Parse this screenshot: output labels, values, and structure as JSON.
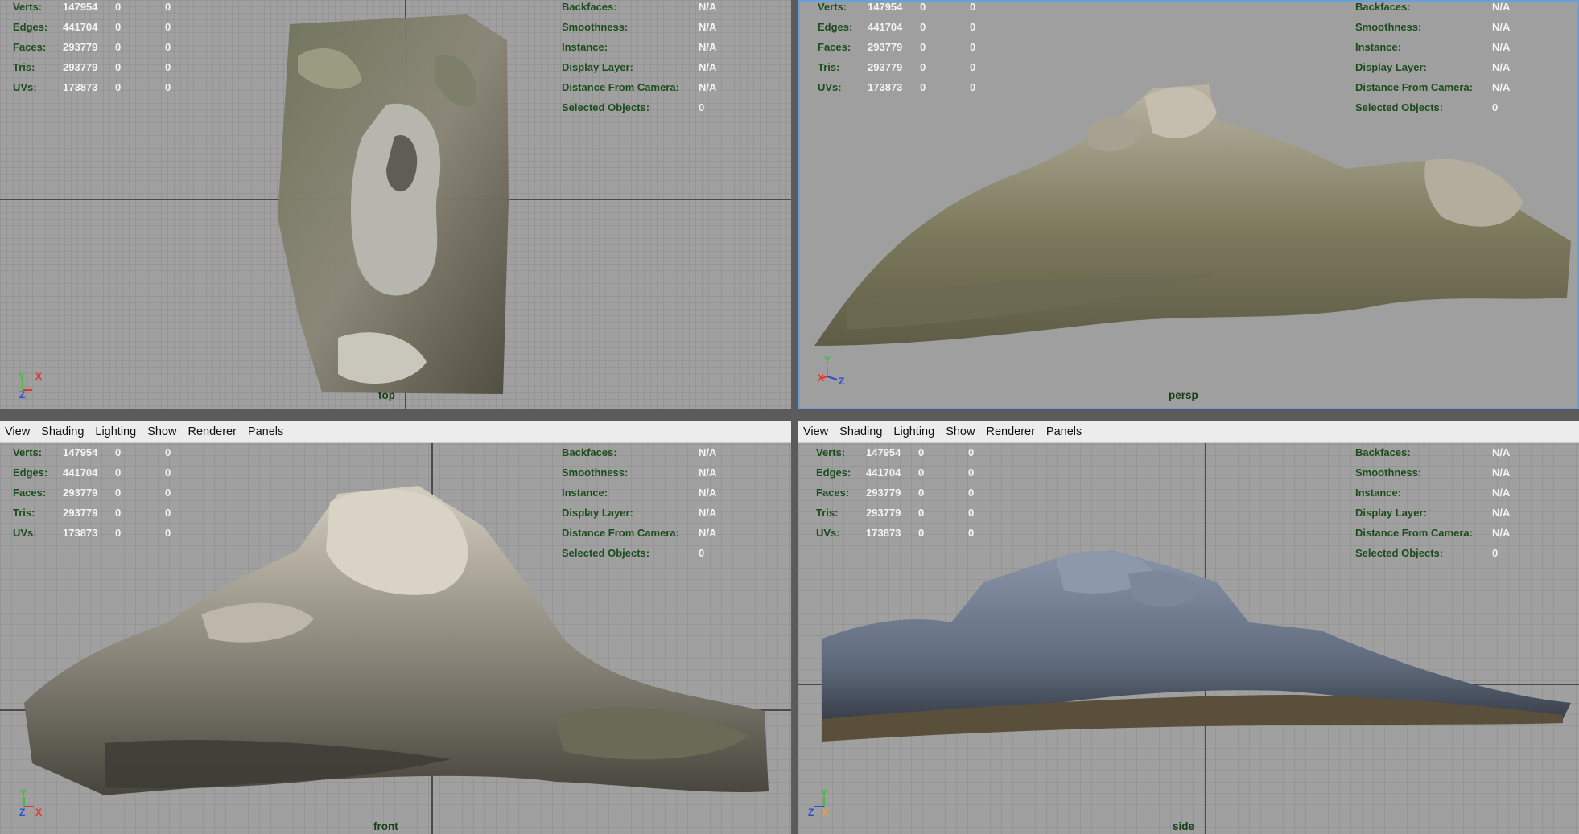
{
  "menu": [
    "View",
    "Shading",
    "Lighting",
    "Show",
    "Renderer",
    "Panels"
  ],
  "hud_left": [
    {
      "label": "Verts:",
      "value": "147954",
      "sel": "0",
      "comp": "0"
    },
    {
      "label": "Edges:",
      "value": "441704",
      "sel": "0",
      "comp": "0"
    },
    {
      "label": "Faces:",
      "value": "293779",
      "sel": "0",
      "comp": "0"
    },
    {
      "label": "Tris:",
      "value": "293779",
      "sel": "0",
      "comp": "0"
    },
    {
      "label": "UVs:",
      "value": "173873",
      "sel": "0",
      "comp": "0"
    }
  ],
  "hud_right": [
    {
      "label": "Backfaces:",
      "value": "N/A"
    },
    {
      "label": "Smoothness:",
      "value": "N/A"
    },
    {
      "label": "Instance:",
      "value": "N/A"
    },
    {
      "label": "Display Layer:",
      "value": "N/A"
    },
    {
      "label": "Distance From Camera:",
      "value": "N/A"
    },
    {
      "label": "Selected Objects:",
      "value": "0"
    }
  ],
  "viewports": {
    "top": {
      "camera": "top"
    },
    "persp": {
      "camera": "persp"
    },
    "front": {
      "camera": "front"
    },
    "side": {
      "camera": "side"
    }
  },
  "axes": {
    "top": [
      "Y",
      "X",
      "Z"
    ],
    "persp": [
      "Y",
      "X",
      "Z"
    ],
    "front": [
      "Y",
      "Z",
      "X"
    ],
    "side": [
      "Y",
      "Z",
      "X"
    ]
  },
  "colors": {
    "viewport_bg": "#a0a0a0",
    "grid_line": "#8c8c8c",
    "grid_axis": "#2f2f2f",
    "hud_label": "#1c4d1c",
    "hud_value": "#f4f4f4",
    "menubar_bg": "#ececec",
    "active_border": "#6aa0d8",
    "axis_x": "#e8332d",
    "axis_y": "#36c436",
    "axis_z": "#2a4dd6"
  }
}
